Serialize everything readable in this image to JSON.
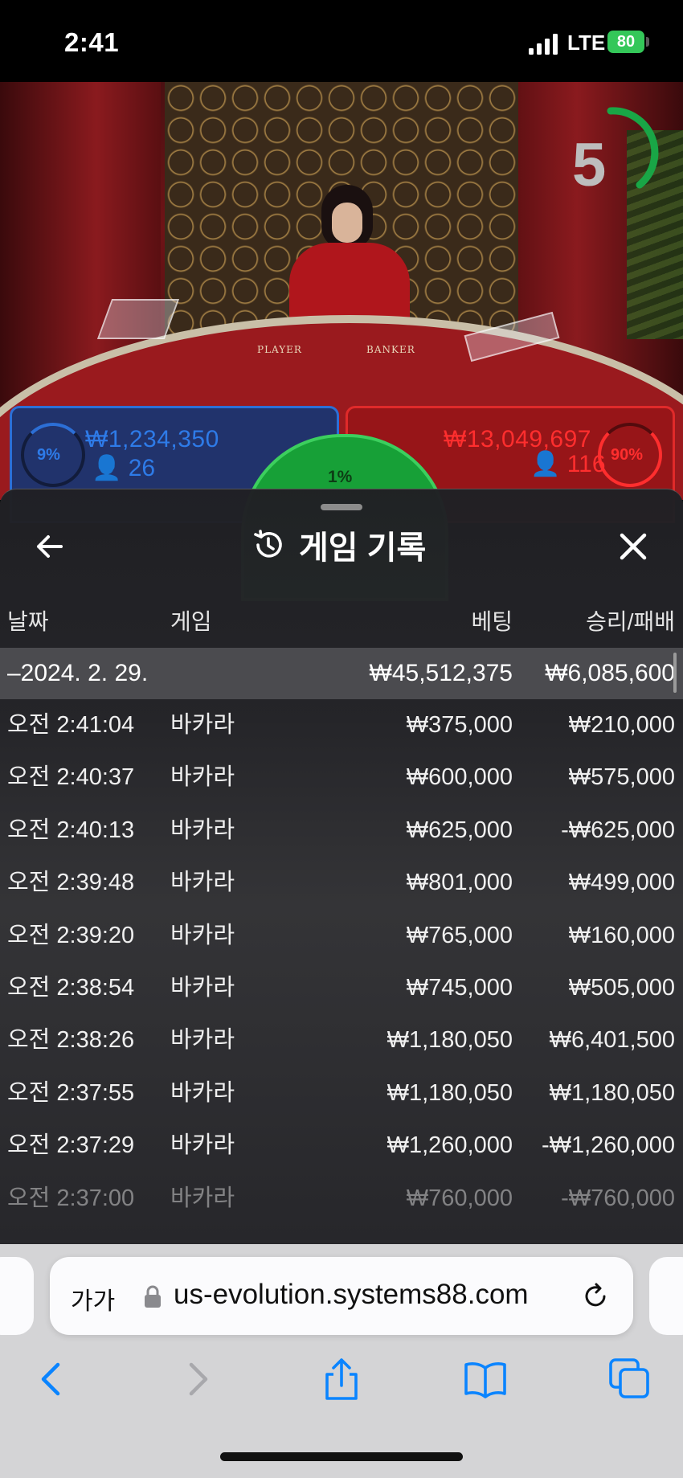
{
  "status_bar": {
    "time": "2:41",
    "network": "LTE",
    "battery": "80"
  },
  "video": {
    "countdown": "5",
    "table_player_label": "PLAYER",
    "table_banker_label": "BANKER",
    "player": {
      "percent": "9%",
      "amount": "₩1,234,350",
      "count": "26"
    },
    "tie": {
      "percent": "1%"
    },
    "banker": {
      "percent": "90%",
      "amount": "₩13,049,697",
      "count": "116"
    }
  },
  "sheet": {
    "title": "게임 기록",
    "columns": {
      "date": "날짜",
      "game": "게임",
      "bet": "베팅",
      "winloss": "승리/패배"
    },
    "day": {
      "date": "–2024. 2. 29.",
      "bet": "₩45,512,375",
      "winloss": "₩6,085,600"
    },
    "rows": [
      {
        "time": "오전 2:41:04",
        "game": "바카라",
        "bet": "₩375,000",
        "winloss": "₩210,000"
      },
      {
        "time": "오전 2:40:37",
        "game": "바카라",
        "bet": "₩600,000",
        "winloss": "₩575,000"
      },
      {
        "time": "오전 2:40:13",
        "game": "바카라",
        "bet": "₩625,000",
        "winloss": "-₩625,000"
      },
      {
        "time": "오전 2:39:48",
        "game": "바카라",
        "bet": "₩801,000",
        "winloss": "₩499,000"
      },
      {
        "time": "오전 2:39:20",
        "game": "바카라",
        "bet": "₩765,000",
        "winloss": "₩160,000"
      },
      {
        "time": "오전 2:38:54",
        "game": "바카라",
        "bet": "₩745,000",
        "winloss": "₩505,000"
      },
      {
        "time": "오전 2:38:26",
        "game": "바카라",
        "bet": "₩1,180,050",
        "winloss": "₩6,401,500"
      },
      {
        "time": "오전 2:37:55",
        "game": "바카라",
        "bet": "₩1,180,050",
        "winloss": "₩1,180,050"
      },
      {
        "time": "오전 2:37:29",
        "game": "바카라",
        "bet": "₩1,260,000",
        "winloss": "-₩1,260,000"
      },
      {
        "time": "오전 2:37:00",
        "game": "바카라",
        "bet": "₩760,000",
        "winloss": "-₩760,000"
      }
    ]
  },
  "safari": {
    "aa_label": "가가",
    "url": "us-evolution.systems88.com"
  },
  "colors": {
    "player_blue": "#2e7be8",
    "banker_red": "#ff2e2e",
    "tie_green": "#17a037",
    "ios_blue": "#0a84ff"
  }
}
